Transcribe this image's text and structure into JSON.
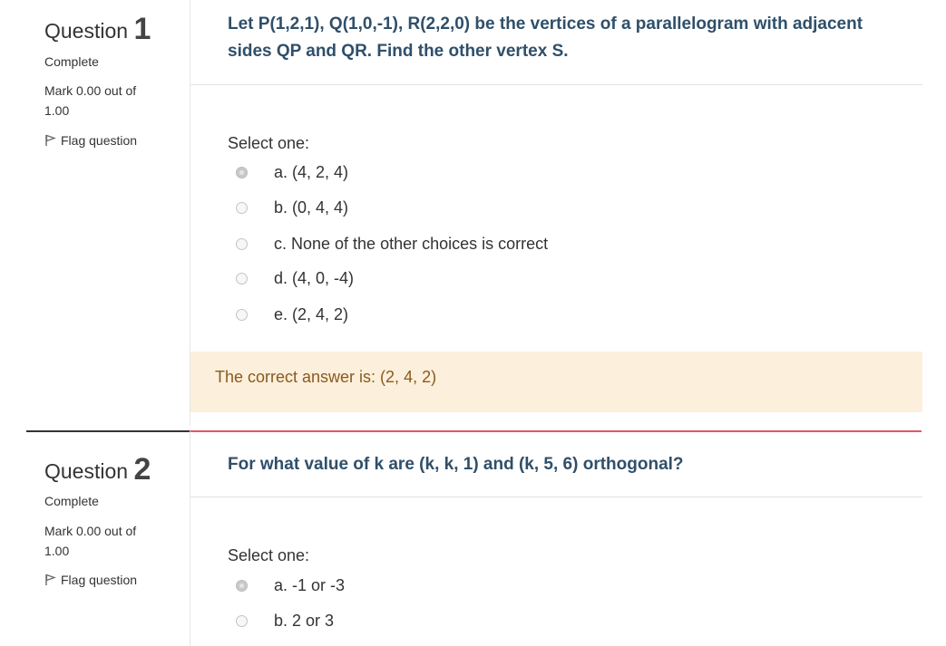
{
  "questions": [
    {
      "label": "Question",
      "number": "1",
      "state": "Complete",
      "grade": "Mark 0.00 out of 1.00",
      "flag_label": "Flag question",
      "text": "Let P(1,2,1), Q(1,0,-1), R(2,2,0) be the vertices of a parallelogram with adjacent sides QP and QR. Find the other vertex S.",
      "prompt": "Select one:",
      "options": [
        {
          "label": "a. (4, 2, 4)",
          "selected": true
        },
        {
          "label": "b. (0, 4, 4)",
          "selected": false
        },
        {
          "label": "c. None of the other choices is correct",
          "selected": false
        },
        {
          "label": "d. (4, 0, -4)",
          "selected": false
        },
        {
          "label": "e. (2, 4, 2)",
          "selected": false
        }
      ],
      "feedback": "The correct answer is: (2, 4, 2)"
    },
    {
      "label": "Question",
      "number": "2",
      "state": "Complete",
      "grade": "Mark 0.00 out of 1.00",
      "flag_label": "Flag question",
      "text": "For what value of k are (k, k, 1) and (k, 5, 6) orthogonal?",
      "prompt": "Select one:",
      "options": [
        {
          "label": "a. -1 or -3",
          "selected": true
        },
        {
          "label": "b. 2 or 3",
          "selected": false
        }
      ]
    }
  ],
  "colors": {
    "question_text": "#2f4f6a",
    "feedback_bg": "#fcefdc",
    "feedback_text": "#8a5a1d",
    "divider_accent": "#e0556a"
  },
  "icons": {
    "flag": "flag-icon"
  }
}
